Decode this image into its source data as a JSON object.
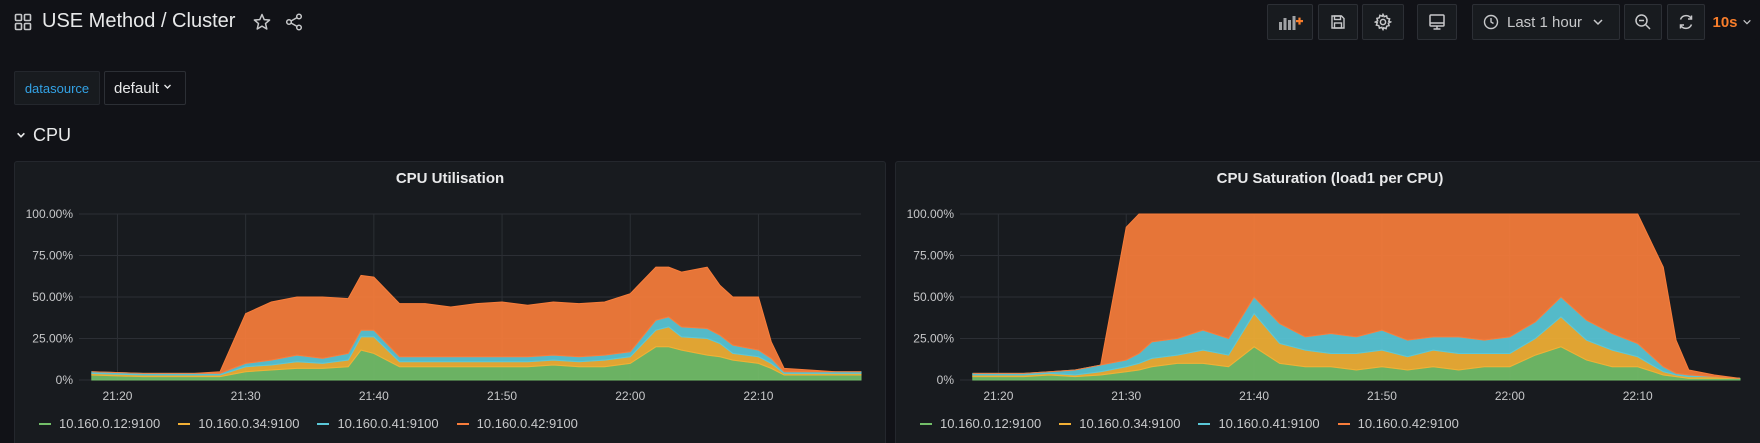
{
  "header": {
    "title": "USE Method / Cluster",
    "time_range": "Last 1 hour",
    "refresh_interval": "10s"
  },
  "variables": {
    "label": "datasource",
    "value": "default"
  },
  "row": {
    "title": "CPU"
  },
  "colors": {
    "accent_blue": "#33a2e5",
    "accent_orange": "#f87d2b",
    "series_green": "#73bf69",
    "series_yellow": "#f2b035",
    "series_cyan": "#5ac8d8",
    "series_orange": "#f87d3b"
  },
  "icons": [
    "apps-grid-icon",
    "star-icon",
    "share-icon",
    "add-panel-icon",
    "save-icon",
    "gear-icon",
    "tv-mode-icon",
    "clock-icon",
    "chevron-down-icon",
    "zoom-out-icon",
    "refresh-icon"
  ],
  "chart_data": [
    {
      "type": "area",
      "stacked": true,
      "title": "CPU Utilisation",
      "x_ticks": [
        "21:20",
        "21:30",
        "21:40",
        "21:50",
        "22:00",
        "22:10"
      ],
      "y_ticks": [
        "0%",
        "25.00%",
        "50.00%",
        "75.00%",
        "100.00%"
      ],
      "ylim": [
        0,
        100
      ],
      "x": [
        "21:18",
        "21:22",
        "21:26",
        "21:28",
        "21:30",
        "21:32",
        "21:34",
        "21:36",
        "21:38",
        "21:39",
        "21:40",
        "21:42",
        "21:44",
        "21:46",
        "21:48",
        "21:50",
        "21:52",
        "21:54",
        "21:56",
        "21:58",
        "22:00",
        "22:02",
        "22:03",
        "22:04",
        "22:06",
        "22:07",
        "22:08",
        "22:10",
        "22:11",
        "22:12",
        "22:14",
        "22:16",
        "22:18"
      ],
      "series": [
        {
          "name": "10.160.0.12:9100",
          "color": "#73bf69",
          "values": [
            3,
            2,
            2,
            2,
            5,
            6,
            7,
            7,
            8,
            18,
            16,
            8,
            8,
            8,
            8,
            8,
            8,
            9,
            8,
            8,
            10,
            20,
            20,
            18,
            15,
            14,
            12,
            10,
            7,
            3,
            3,
            3,
            3
          ]
        },
        {
          "name": "10.160.0.34:9100",
          "color": "#f2b035",
          "values": [
            1,
            1,
            1,
            1,
            3,
            3,
            4,
            3,
            4,
            8,
            10,
            3,
            3,
            3,
            3,
            3,
            3,
            3,
            3,
            4,
            4,
            10,
            12,
            8,
            10,
            8,
            4,
            4,
            3,
            1,
            1,
            1,
            1
          ]
        },
        {
          "name": "10.160.0.41:9100",
          "color": "#5ac8d8",
          "values": [
            1,
            1,
            1,
            1,
            2,
            3,
            4,
            3,
            4,
            4,
            4,
            3,
            3,
            3,
            3,
            3,
            3,
            3,
            3,
            3,
            3,
            6,
            6,
            6,
            6,
            5,
            5,
            4,
            3,
            1,
            1,
            1,
            1
          ]
        },
        {
          "name": "10.160.0.42:9100",
          "color": "#f87d3b",
          "values": [
            0,
            0,
            0,
            1,
            30,
            35,
            35,
            37,
            33,
            33,
            32,
            32,
            32,
            30,
            32,
            33,
            31,
            32,
            32,
            32,
            35,
            32,
            30,
            33,
            37,
            30,
            29,
            32,
            10,
            2,
            1,
            0,
            0
          ]
        }
      ]
    },
    {
      "type": "area",
      "stacked": true,
      "title": "CPU Saturation (load1 per CPU)",
      "x_ticks": [
        "21:20",
        "21:30",
        "21:40",
        "21:50",
        "22:00",
        "22:10"
      ],
      "y_ticks": [
        "0%",
        "25.00%",
        "50.00%",
        "75.00%",
        "100.00%"
      ],
      "ylim": [
        0,
        100
      ],
      "x": [
        "21:18",
        "21:22",
        "21:24",
        "21:26",
        "21:28",
        "21:30",
        "21:31",
        "21:32",
        "21:34",
        "21:36",
        "21:38",
        "21:40",
        "21:42",
        "21:44",
        "21:46",
        "21:48",
        "21:50",
        "21:52",
        "21:54",
        "21:56",
        "21:58",
        "22:00",
        "22:02",
        "22:04",
        "22:06",
        "22:08",
        "22:10",
        "22:12",
        "22:13",
        "22:14",
        "22:16",
        "22:18"
      ],
      "series": [
        {
          "name": "10.160.0.12:9100",
          "color": "#73bf69",
          "values": [
            2,
            2,
            3,
            2,
            3,
            5,
            6,
            8,
            10,
            10,
            8,
            20,
            10,
            8,
            8,
            6,
            8,
            6,
            8,
            6,
            8,
            8,
            15,
            20,
            12,
            8,
            8,
            3,
            2,
            1,
            1,
            1
          ]
        },
        {
          "name": "10.160.0.34:9100",
          "color": "#f2b035",
          "values": [
            1,
            1,
            1,
            1,
            2,
            3,
            4,
            5,
            5,
            8,
            7,
            20,
            12,
            10,
            8,
            10,
            10,
            8,
            10,
            10,
            8,
            8,
            10,
            18,
            12,
            10,
            6,
            2,
            1,
            1,
            1,
            0
          ]
        },
        {
          "name": "10.160.0.41:9100",
          "color": "#5ac8d8",
          "values": [
            1,
            1,
            1,
            3,
            4,
            4,
            6,
            10,
            10,
            12,
            10,
            10,
            12,
            8,
            12,
            10,
            12,
            10,
            8,
            10,
            8,
            10,
            10,
            12,
            12,
            10,
            8,
            3,
            1,
            1,
            0,
            0
          ]
        },
        {
          "name": "10.160.0.42:9100",
          "color": "#f87d3b",
          "values": [
            0,
            0,
            0,
            0,
            0,
            80,
            84,
            77,
            75,
            70,
            75,
            50,
            66,
            74,
            72,
            74,
            70,
            76,
            74,
            74,
            76,
            74,
            65,
            50,
            64,
            72,
            78,
            60,
            20,
            3,
            1,
            0
          ]
        }
      ]
    }
  ]
}
